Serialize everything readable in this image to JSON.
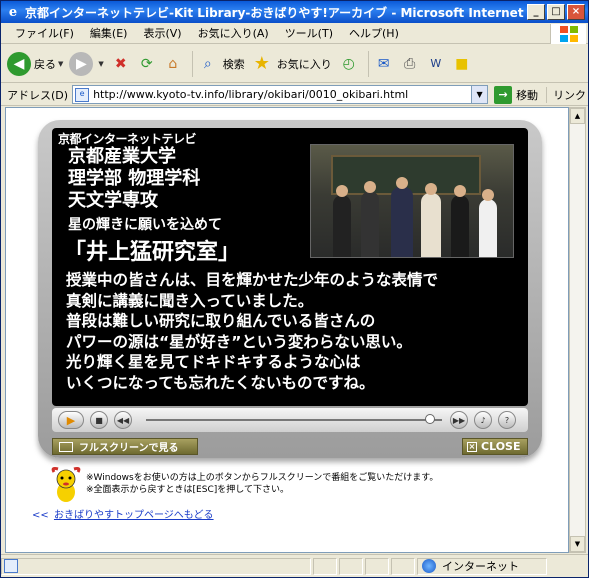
{
  "window": {
    "title": "京都インターネットテレビ-Kit Library-おきばりやす!アーカイブ - Microsoft Internet Explorer",
    "minimize": "_",
    "maximize": "□",
    "close": "×"
  },
  "menu": [
    "ファイル(F)",
    "編集(E)",
    "表示(V)",
    "お気に入り(A)",
    "ツール(T)",
    "ヘルプ(H)"
  ],
  "toolbar": {
    "back": "戻る",
    "search": "検索",
    "favorites": "お気に入り"
  },
  "address": {
    "label": "アドレス(D)",
    "url": "http://www.kyoto-tv.info/library/okibari/0010_okibari.html",
    "go": "移動",
    "links": "リンク"
  },
  "player": {
    "channel_logo": "京都インターネットテレビ",
    "university": "京都産業大学",
    "faculty": "理学部 物理学科",
    "major": "天文学専攻",
    "tagline": "星の輝きに願いを込めて",
    "lab_name": "「井上猛研究室」",
    "body_lines": [
      "授業中の皆さんは、目を輝かせた少年のような表情で",
      "真剣に講義に聞き入っていました。",
      "普段は難しい研究に取り組んでいる皆さんの",
      "パワーの源は“星が好き”という変わらない思い。",
      "光り輝く星を見てドキドキするような心は",
      "いくつになっても忘れたくないものですね。"
    ],
    "seek_progress": 0.96,
    "fullscreen_button": "フルスクリーンで見る",
    "close_button": "CLOSE"
  },
  "notes": {
    "line1": "※Windowsをお使いの方は上のボタンからフルスクリーンで番組をご覧いただけます。",
    "line2": "※全面表示から戻すときは[ESC]を押して下さい。"
  },
  "back_link": {
    "arrow": "<<",
    "text": "おきばりやすトップページへもどる"
  },
  "status": {
    "zone": "インターネット"
  }
}
